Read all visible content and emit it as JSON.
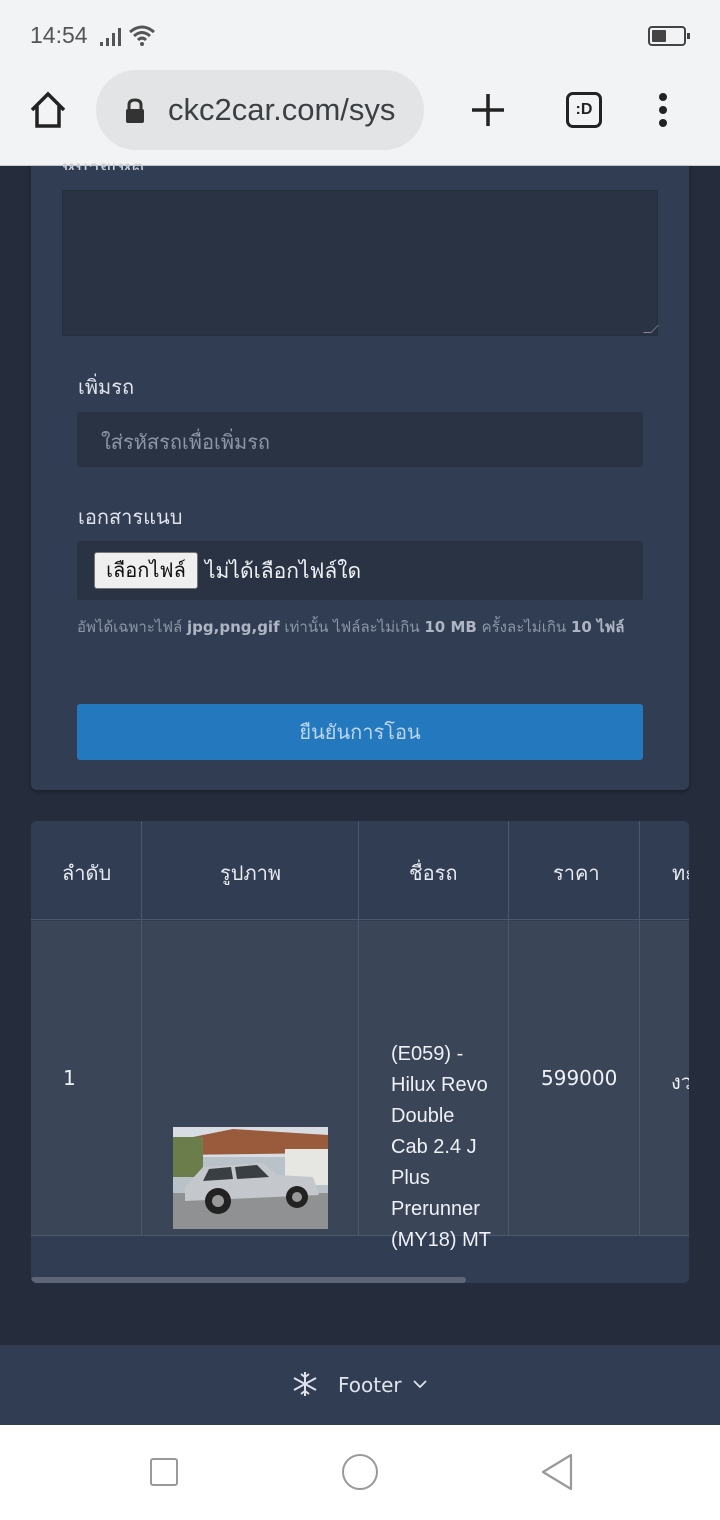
{
  "status_bar": {
    "time": "14:54"
  },
  "browser": {
    "url": "ckc2car.com/sys",
    "tabs_label": ":D"
  },
  "form": {
    "cut_label": "หมายเหตุ",
    "add_car_label": "เพิ่มรถ",
    "add_car_placeholder": "ใส่รหัสรถเพื่อเพิ่มรถ",
    "attachment_label": "เอกสารแนบ",
    "file_button": "เลือกไฟล์",
    "file_none": "ไม่ได้เลือกไฟล์ใด",
    "hint_part1": "อัพได้เฉพาะไฟล์ ",
    "hint_types": "jpg,png,gif",
    "hint_part2": " เท่านั้น ไฟล์ละไม่เกิน ",
    "hint_size": "10 MB",
    "hint_part3": " ครั้งละไม่เกิน ",
    "hint_count": "10 ไฟล์",
    "submit_label": "ยืนยันการโอน"
  },
  "table": {
    "headers": [
      "ลำดับ",
      "รูปภาพ",
      "ชื่อรถ",
      "ราคา",
      "ทะ"
    ],
    "rows": [
      {
        "index": "1",
        "name": "(E059) - Hilux Revo Double Cab 2.4 J Plus Prerunner (MY18) MT",
        "price": "599000",
        "extra": "งว"
      }
    ]
  },
  "footer": {
    "label": "Footer"
  }
}
